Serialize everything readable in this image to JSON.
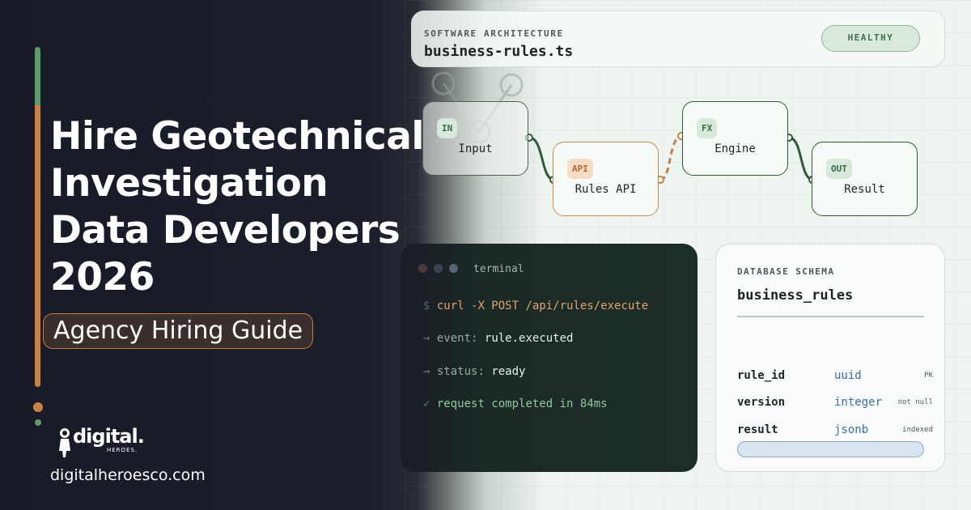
{
  "headline": {
    "lines": [
      "Hire Geotechnical",
      "Investigation",
      "Data Developers",
      "2026"
    ],
    "tag": "Agency Hiring Guide"
  },
  "brand": {
    "logo_word": "digital.",
    "logo_sub": "HEROES.",
    "url": "digitalheroesco.com"
  },
  "colors": {
    "accent_green": "#5f9a68",
    "accent_orange": "#cf7f44",
    "status_green": "#3f6e4a"
  },
  "header_card": {
    "eyebrow": "SOFTWARE ARCHITECTURE",
    "filename": "business-rules.ts",
    "status": "HEALTHY"
  },
  "flow": {
    "nodes": [
      {
        "tag": "IN",
        "label": "Input"
      },
      {
        "tag": "API",
        "label": "Rules API"
      },
      {
        "tag": "FX",
        "label": "Engine"
      },
      {
        "tag": "OUT",
        "label": "Result"
      }
    ]
  },
  "terminal": {
    "title": "terminal",
    "command_prompt": "$",
    "command": "curl -X POST /api/rules/execute",
    "lines": [
      {
        "marker": "→",
        "key": "event:",
        "value": "rule.executed"
      },
      {
        "marker": "→",
        "key": "status:",
        "value": "ready"
      }
    ],
    "done_marker": "✓",
    "done_text": "request completed in 84ms"
  },
  "schema": {
    "eyebrow": "DATABASE SCHEMA",
    "table": "business_rules",
    "rows": [
      {
        "column": "rule_id",
        "type": "uuid",
        "note": "PK"
      },
      {
        "column": "version",
        "type": "integer",
        "note": "not null"
      },
      {
        "column": "result",
        "type": "jsonb",
        "note": "indexed"
      }
    ]
  }
}
